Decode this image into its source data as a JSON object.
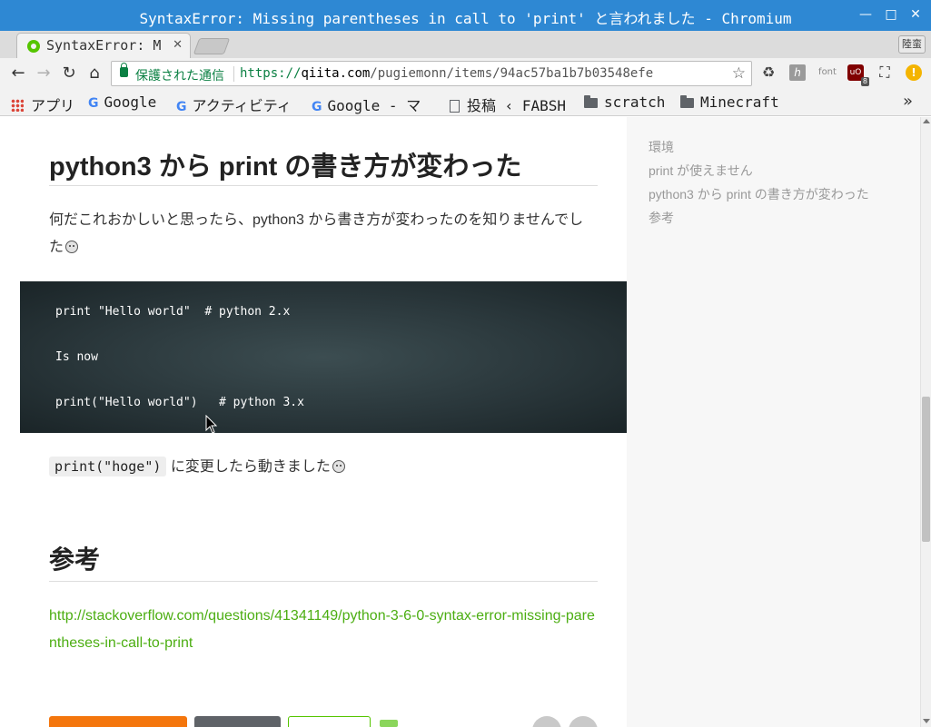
{
  "window": {
    "title": "SyntaxError: Missing parentheses in call to 'print' と言われました - Chromium",
    "controls": {
      "minimize": "—",
      "maximize": "□",
      "close": "✕"
    }
  },
  "tabs": [
    {
      "label": "SyntaxError: M",
      "close": "✕",
      "active": true
    }
  ],
  "profile_label": "陸蛮",
  "toolbar": {
    "back": "←",
    "forward": "→",
    "reload": "↻",
    "home": "⌂",
    "secure_label": "保護された通信",
    "url_scheme": "https://",
    "url_host": "qiita.com",
    "url_path": "/pugiemonn/items/94ac57ba1b7b03548efe",
    "star": "☆",
    "extensions": {
      "recycle": "♻",
      "hatena": "h",
      "font": "font",
      "ublock": "uO",
      "ublock_count": "8",
      "cast": "⛶",
      "alert": "!"
    }
  },
  "bookmarks": {
    "items": [
      {
        "label": "アプリ",
        "icon": "apps-grid-icon"
      },
      {
        "label": "Google",
        "icon": "google-icon"
      },
      {
        "label": "アクティビティ",
        "icon": "google-icon"
      },
      {
        "label": "Google - マ",
        "icon": "google-icon"
      },
      {
        "label": "投稿 ‹ FABSH",
        "icon": "document-icon"
      },
      {
        "label": "scratch",
        "icon": "folder-icon"
      },
      {
        "label": "Minecraft",
        "icon": "folder-icon"
      }
    ],
    "more": "»"
  },
  "article": {
    "heading_print_change": "python3 から print の書き方が変わった",
    "para_intro": "何だこれおかしいと思ったら、python3 から書き方が変わったのを知りませんでした",
    "code_lines": [
      "print \"Hello world\"  # python 2.x",
      "Is now",
      "print(\"Hello world\")   # python 3.x"
    ],
    "inline_code": "print(\"hoge\")",
    "para_fixed": "に変更したら動きました",
    "heading_refs": "参考",
    "ref_link": "http://stackoverflow.com/questions/41341149/python-3-6-0-syntax-error-missing-parentheses-in-call-to-print"
  },
  "toc": [
    "環境",
    "print が使えません",
    "python3 から print の書き方が変わった",
    "参考"
  ],
  "colors": {
    "titlebar": "#2e88d3",
    "qiita_green": "#55c500",
    "link_green": "#4cae12",
    "secure_green": "#0b8043",
    "stock_orange": "#f4760d"
  }
}
